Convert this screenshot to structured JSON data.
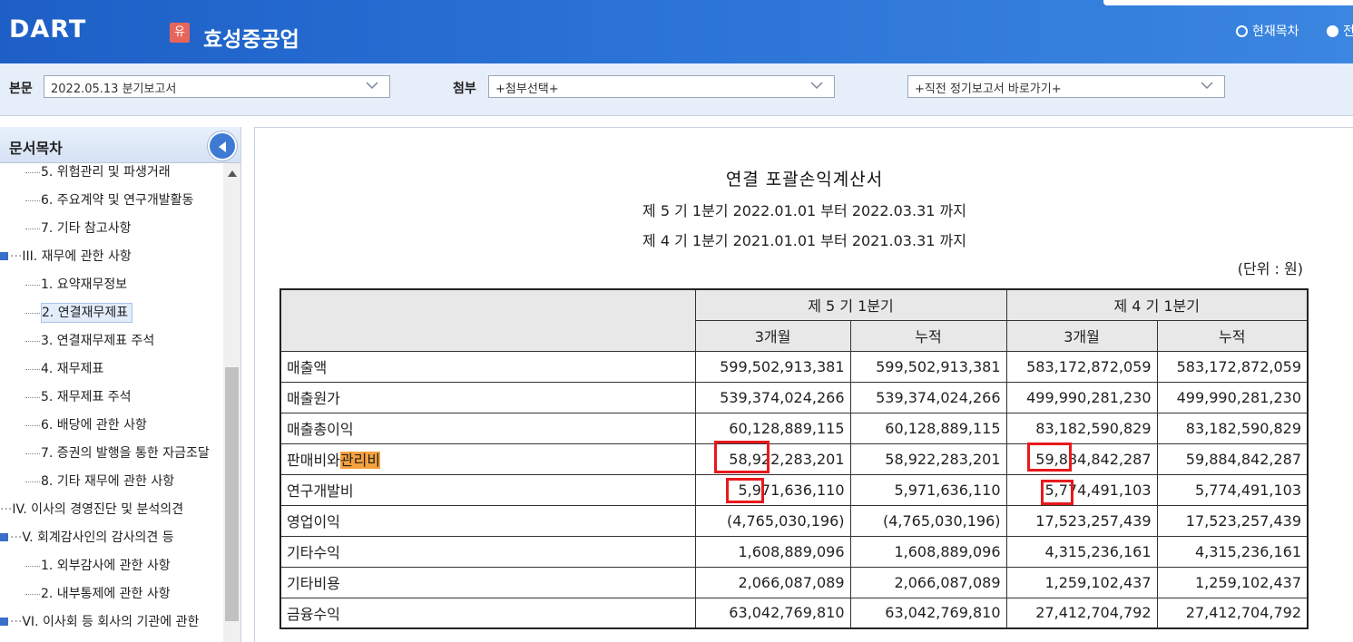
{
  "header": {
    "logo": "DART",
    "badge": "유",
    "company": "효성중공업",
    "radio_current": "현재목차",
    "radio_all": "전"
  },
  "toolbar": {
    "main_label": "본문",
    "main_value": "2022.05.13  분기보고서",
    "attach_label": "첨부",
    "attach_value": "+첨부선택+",
    "prev_value": "+직전 정기보고서 바로가기+"
  },
  "sidebar": {
    "title": "문서목차",
    "items": [
      {
        "label": "5. 위험관리 및 파생거래",
        "level": "sub"
      },
      {
        "label": "6. 주요계약 및 연구개발활동",
        "level": "sub"
      },
      {
        "label": "7. 기타 참고사항",
        "level": "sub"
      },
      {
        "label": "III. 재무에 관한 사항",
        "level": "top"
      },
      {
        "label": "1. 요약재무정보",
        "level": "sub"
      },
      {
        "label": "2. 연결재무제표",
        "level": "sub",
        "selected": true
      },
      {
        "label": "3. 연결재무제표 주석",
        "level": "sub"
      },
      {
        "label": "4. 재무제표",
        "level": "sub"
      },
      {
        "label": "5. 재무제표 주석",
        "level": "sub"
      },
      {
        "label": "6. 배당에 관한 사항",
        "level": "sub"
      },
      {
        "label": "7. 증권의 발행을 통한 자금조달",
        "level": "sub"
      },
      {
        "label": "8. 기타 재무에 관한 사항",
        "level": "sub"
      },
      {
        "label": "IV. 이사의 경영진단 및 분석의견",
        "level": "plain"
      },
      {
        "label": "V. 회계감사인의 감사의견 등",
        "level": "top"
      },
      {
        "label": "1. 외부감사에 관한 사항",
        "level": "sub"
      },
      {
        "label": "2. 내부통제에 관한 사항",
        "level": "sub"
      },
      {
        "label": "VI. 이사회 등 회사의 기관에 관한",
        "level": "top"
      }
    ]
  },
  "document": {
    "title": "연결 포괄손익계산서",
    "period1": "제 5 기 1분기 2022.01.01 부터 2022.03.31 까지",
    "period2": "제 4 기 1분기 2021.01.01 부터 2021.03.31 까지",
    "unit": "(단위 : 원)",
    "col_group1": "제 5 기 1분기",
    "col_group2": "제 4 기 1분기",
    "sub_3m": "3개월",
    "sub_cum": "누적",
    "rows": [
      {
        "label": "매출액",
        "v": [
          "599,502,913,381",
          "599,502,913,381",
          "583,172,872,059",
          "583,172,872,059"
        ]
      },
      {
        "label": "매출원가",
        "v": [
          "539,374,024,266",
          "539,374,024,266",
          "499,990,281,230",
          "499,990,281,230"
        ]
      },
      {
        "label": "매출총이익",
        "v": [
          "60,128,889,115",
          "60,128,889,115",
          "83,182,590,829",
          "83,182,590,829"
        ]
      },
      {
        "label_pre": "판매비와",
        "label_hl": "관리비",
        "v": [
          "58,922,283,201",
          "58,922,283,201",
          "59,884,842,287",
          "59,884,842,287"
        ]
      },
      {
        "label": "연구개발비",
        "v": [
          "5,971,636,110",
          "5,971,636,110",
          "5,774,491,103",
          "5,774,491,103"
        ]
      },
      {
        "label": "영업이익",
        "v": [
          "(4,765,030,196)",
          "(4,765,030,196)",
          "17,523,257,439",
          "17,523,257,439"
        ]
      },
      {
        "label": "기타수익",
        "v": [
          "1,608,889,096",
          "1,608,889,096",
          "4,315,236,161",
          "4,315,236,161"
        ]
      },
      {
        "label": "기타비용",
        "v": [
          "2,066,087,089",
          "2,066,087,089",
          "1,259,102,437",
          "1,259,102,437"
        ]
      },
      {
        "label": "금융수익",
        "v": [
          "63,042,769,810",
          "63,042,769,810",
          "27,412,704,792",
          "27,412,704,792"
        ]
      }
    ]
  }
}
